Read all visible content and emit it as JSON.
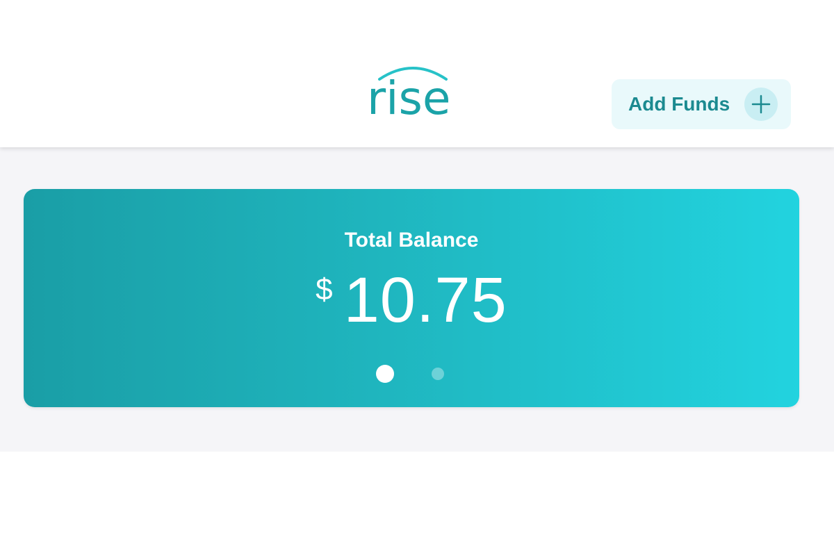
{
  "app": {
    "logo_text": "rise"
  },
  "header": {
    "add_funds_label": "Add Funds",
    "add_funds_icon": "plus-icon"
  },
  "balance": {
    "label": "Total Balance",
    "currency_symbol": "$",
    "amount": "10.75",
    "pager": {
      "total_pages": 2,
      "active_index": 0
    }
  },
  "colors": {
    "brand_teal": "#1ba3a8",
    "card_gradient_start": "#1a9ea6",
    "card_gradient_end": "#22d3df",
    "button_bg": "#e9f9fb"
  }
}
